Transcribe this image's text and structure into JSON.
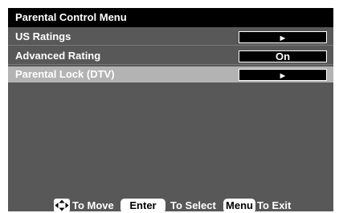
{
  "menu": {
    "title": "Parental Control Menu",
    "items": [
      {
        "label": "US Ratings",
        "value": "►"
      },
      {
        "label": "Advanced Rating",
        "value": "On"
      },
      {
        "label": "Parental Lock (DTV)",
        "value": "►",
        "highlighted": true
      }
    ]
  },
  "footer": {
    "move_icon": "dpad-arrows-icon",
    "move_label": "To Move",
    "enter_key": "Enter",
    "select_label": "To Select",
    "menu_key": "Menu",
    "exit_label": "To Exit"
  },
  "colors": {
    "background": "#585858",
    "title_bar": "#000000",
    "highlight": "#b3b3b3",
    "value_box": "#000000",
    "text": "#ffffff"
  }
}
